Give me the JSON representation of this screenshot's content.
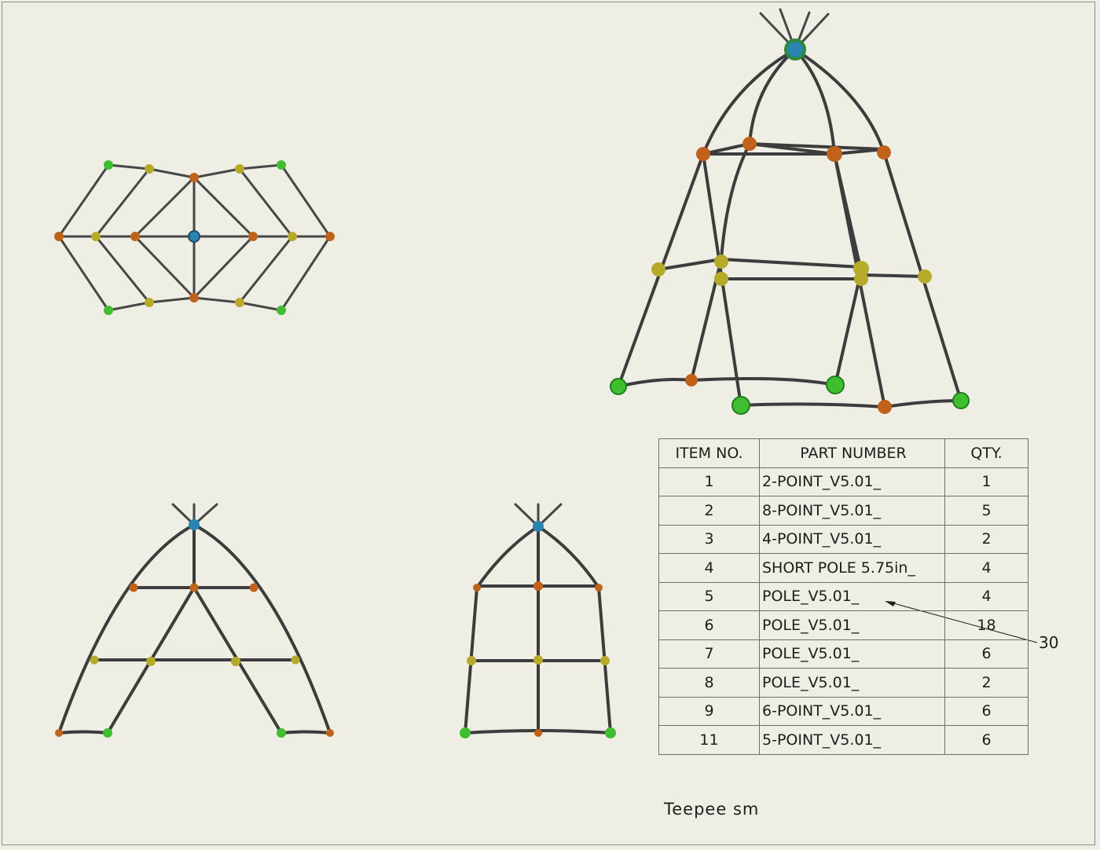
{
  "bom": {
    "headers": [
      "ITEM NO.",
      "PART NUMBER",
      "QTY."
    ],
    "rows": [
      {
        "item": "1",
        "part": "2-POINT_V5.01_",
        "qty": "1"
      },
      {
        "item": "2",
        "part": "8-POINT_V5.01_",
        "qty": "5"
      },
      {
        "item": "3",
        "part": "4-POINT_V5.01_",
        "qty": "2"
      },
      {
        "item": "4",
        "part": "SHORT POLE 5.75in_",
        "qty": "4"
      },
      {
        "item": "5",
        "part": "POLE_V5.01_",
        "qty": "4"
      },
      {
        "item": "6",
        "part": "POLE_V5.01_",
        "qty": "18"
      },
      {
        "item": "7",
        "part": "POLE_V5.01_",
        "qty": "6"
      },
      {
        "item": "8",
        "part": "POLE_V5.01_",
        "qty": "2"
      },
      {
        "item": "9",
        "part": "6-POINT_V5.01_",
        "qty": "6"
      },
      {
        "item": "11",
        "part": "5-POINT_V5.01_",
        "qty": "6"
      }
    ]
  },
  "balloon": "30",
  "drawing_title": "Teepee sm",
  "colors": {
    "pole": "#3c3c3c",
    "connector_green": "#3fbf2f",
    "connector_orange": "#c0621a",
    "connector_yellow": "#b5aa2a",
    "connector_blue": "#2a84b0"
  }
}
